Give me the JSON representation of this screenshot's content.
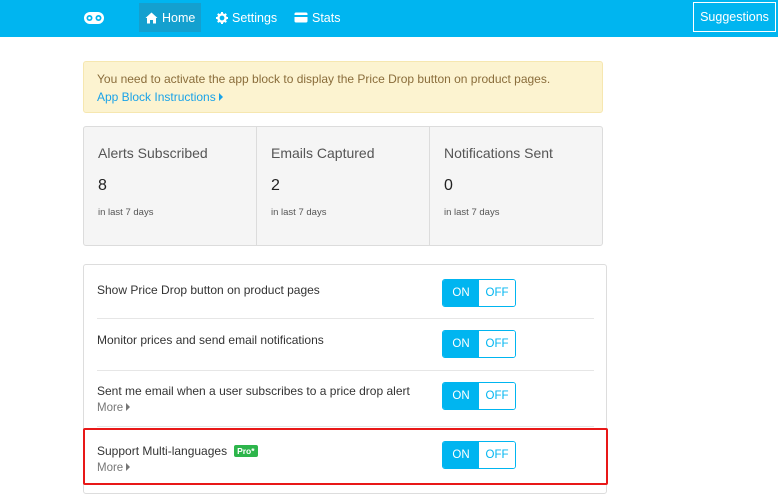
{
  "nav": {
    "home": "Home",
    "settings": "Settings",
    "stats": "Stats",
    "suggestions": "Suggestions"
  },
  "alert": {
    "text": "You need to activate the app block to display the Price Drop button on product pages.",
    "link": "App Block Instructions"
  },
  "stats": [
    {
      "label": "Alerts Subscribed",
      "value": "8",
      "period": "in last 7 days"
    },
    {
      "label": "Emails Captured",
      "value": "2",
      "period": "in last 7 days"
    },
    {
      "label": "Notifications Sent",
      "value": "0",
      "period": "in last 7 days"
    }
  ],
  "settings": [
    {
      "label": "Show Price Drop button on product pages",
      "on": "ON",
      "off": "OFF"
    },
    {
      "label": "Monitor prices and send email notifications",
      "on": "ON",
      "off": "OFF"
    },
    {
      "label": "Sent me email when a user subscribes to a price drop alert",
      "more": "More",
      "on": "ON",
      "off": "OFF"
    },
    {
      "label": "Support Multi-languages",
      "badge": "Pro*",
      "more": "More",
      "on": "ON",
      "off": "OFF"
    }
  ],
  "colors": {
    "primary": "#00b5f0",
    "alert_bg": "#fcf3d0",
    "pro_badge": "#2db54b",
    "highlight": "#e81818"
  }
}
